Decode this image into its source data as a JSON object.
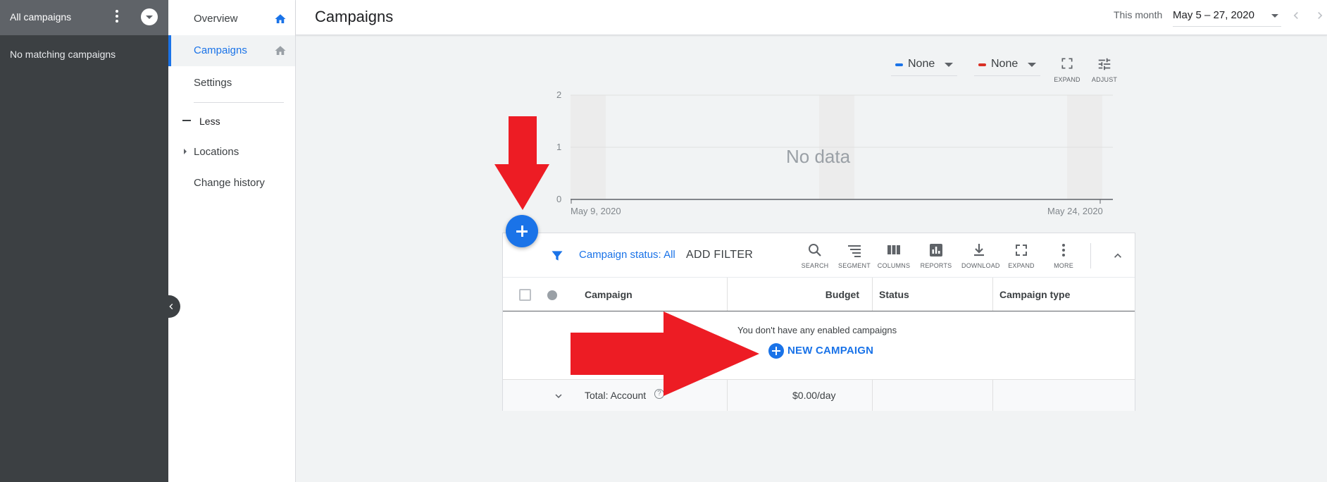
{
  "account_panel": {
    "title": "All campaigns",
    "empty_text": "No matching campaigns"
  },
  "nav": {
    "items": [
      {
        "label": "Overview"
      },
      {
        "label": "Campaigns"
      },
      {
        "label": "Settings"
      }
    ],
    "less_label": "Less",
    "locations_label": "Locations",
    "change_history_label": "Change history"
  },
  "header": {
    "title": "Campaigns",
    "range_label": "This month",
    "date_range": "May 5 – 27, 2020"
  },
  "chart_controls": {
    "metric1": "None",
    "metric2": "None",
    "metric1_color": "#1a73e8",
    "metric2_color": "#d93025",
    "expand_label": "EXPAND",
    "adjust_label": "ADJUST"
  },
  "chart_data": {
    "type": "line",
    "series": [],
    "y_ticks": [
      "2",
      "1",
      "0"
    ],
    "ylim": [
      0,
      2
    ],
    "x_tick_labels": [
      "May 9, 2020",
      "May 24, 2020"
    ],
    "empty_message": "No data",
    "grid": true
  },
  "table": {
    "filter_label": "Campaign status:",
    "filter_value": "All",
    "add_filter": "ADD FILTER",
    "toolbar": [
      {
        "label": "SEARCH",
        "icon": "search-icon"
      },
      {
        "label": "SEGMENT",
        "icon": "segment-icon"
      },
      {
        "label": "COLUMNS",
        "icon": "columns-icon"
      },
      {
        "label": "REPORTS",
        "icon": "reports-icon"
      },
      {
        "label": "DOWNLOAD",
        "icon": "download-icon"
      },
      {
        "label": "EXPAND",
        "icon": "expand-icon"
      },
      {
        "label": "MORE",
        "icon": "more-vert-icon"
      }
    ],
    "columns": [
      "Campaign",
      "Budget",
      "Status",
      "Campaign type"
    ],
    "empty_message": "You don't have any enabled campaigns",
    "new_campaign": "NEW CAMPAIGN",
    "total_label": "Total: Account",
    "total_budget": "$0.00/day",
    "help_glyph": "?"
  },
  "annotation": {
    "arrow_color": "#ed1c24"
  }
}
